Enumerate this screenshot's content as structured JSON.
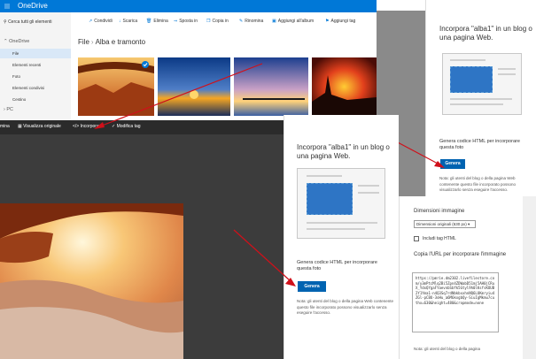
{
  "onedrive": {
    "title": "OneDrive",
    "search_placeholder": "Cerca tutti gli elementi",
    "commands": [
      "Condividi",
      "Scarica",
      "Elimina",
      "Sposta in",
      "Copia in",
      "Rinomina",
      "Aggiungi all'album",
      "Aggiungi tag"
    ],
    "nav": {
      "section": "OneDrive",
      "items": [
        "File",
        "Elementi recenti",
        "Foto",
        "Elementi condivisi",
        "Cestino"
      ],
      "pc_section": "PC"
    },
    "breadcrumb": {
      "root": "File",
      "current": "Alba e tramonto"
    },
    "bottom_bar": [
      "mina",
      "Visualizza originale",
      "Incorpora",
      "Modifica tag"
    ]
  },
  "embed_panel_back": {
    "title": "Incorpora \"alba1\" in un blog o una pagina Web.",
    "subtitle": "Genera codice HTML per incorporare questa foto",
    "button": "Genera",
    "note": "Nota: gli utenti del blog o della pagina Web contenente questo file incorporato possono visualizzarlo senza eseguire l'accesso."
  },
  "embed_panel_front": {
    "title": "Incorpora \"alba1\" in un blog o una pagina Web.",
    "subtitle": "Genera codice HTML per incorporare questa foto",
    "button": "Genera",
    "note": "Nota: gli utenti del blog o della pagina Web contenente questo file incorporato possono visualizzarlo senza eseguire l'accesso."
  },
  "options_panel": {
    "dimensions_label": "Dimensioni immagine",
    "dimensions_value": "Dimensioni originali (630 px)",
    "include_tag": "Includi tag HTML",
    "copy_url_label": "Copia l'URL per incorporare l'immagine",
    "code": "https://pmrie.dm2302.livefilestore.com/y3mPtcMlq2Bi5Zpn4ZDWabD51mj5AH0jCRuX_YdxQYgaFYaevnbSbfk5Gtyl9h0lKsfsKOUB2Y1Yma1-n4Q3Sq7rdNbkbxxhnNQ6LUKmryiu4ZGl-pCBU-3oHu_a6M6kxgbQy-SiuIgMkmu7cuthx=630&height=480&cropmode=none",
    "note": "Nota: gli utenti del blog o della pagina"
  }
}
